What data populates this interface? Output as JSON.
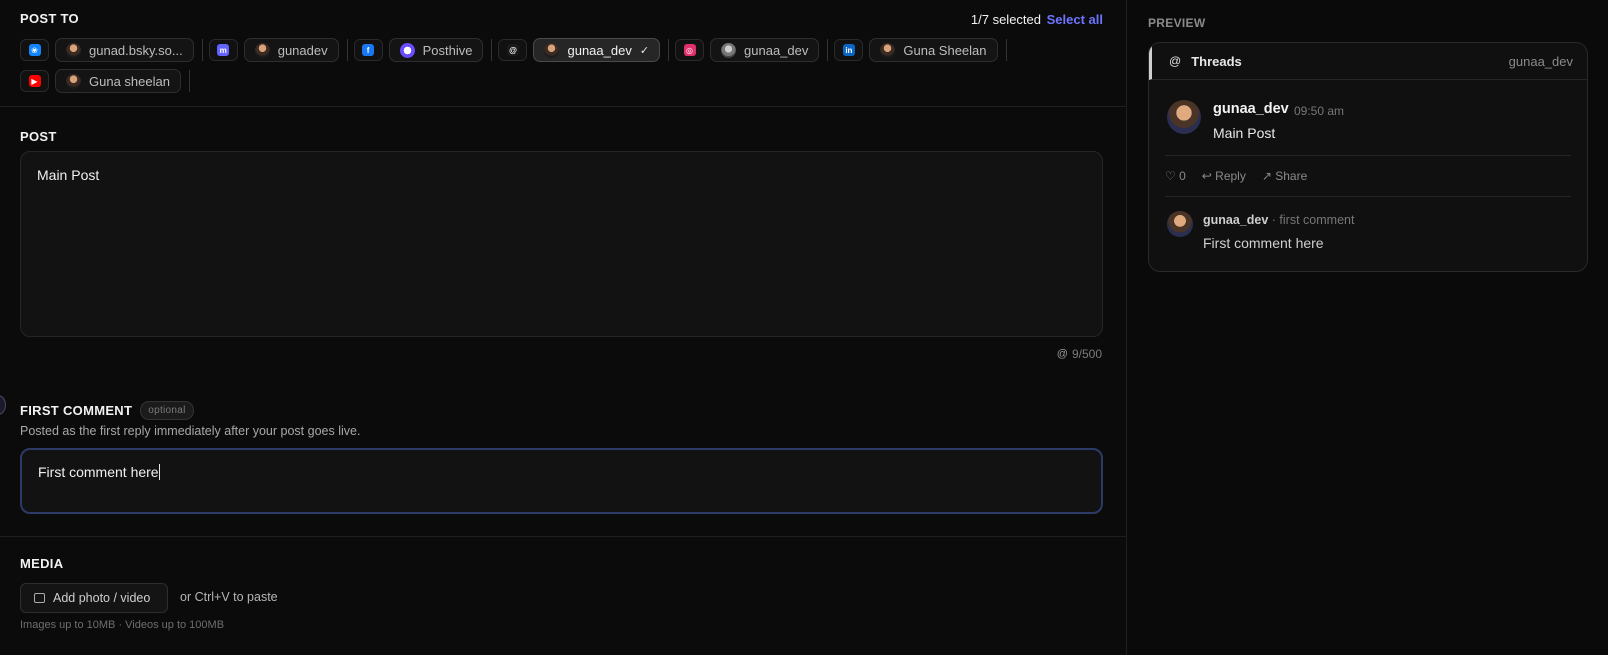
{
  "post_to": {
    "label": "POST TO",
    "selected_count": "1/7 selected",
    "select_all": "Select all",
    "row1": [
      {
        "platform": "bluesky-icon",
        "color": "#1185fe",
        "glyph": "❀",
        "account": "gunad.bsky.so...",
        "active": false
      },
      {
        "platform": "mastodon-icon",
        "color": "#6364ff",
        "glyph": "m",
        "account": "gunadev",
        "active": false
      },
      {
        "platform": "facebook-icon",
        "color": "#1877f2",
        "glyph": "f",
        "account": "Posthive",
        "active": false
      },
      {
        "platform": "threads-icon",
        "color": "#1a1a1a",
        "glyph": "@",
        "account": "gunaa_dev",
        "active": true
      },
      {
        "platform": "instagram-icon",
        "color": "#e1306c",
        "glyph": "◎",
        "account": "gunaa_dev",
        "active": false
      },
      {
        "platform": "linkedin-icon",
        "color": "#0a66c2",
        "glyph": "in",
        "account": "Guna Sheelan",
        "active": false
      }
    ],
    "row2": [
      {
        "platform": "youtube-icon",
        "color": "#ff0000",
        "glyph": "▶",
        "account": "Guna sheelan",
        "active": false
      }
    ],
    "check": "✓"
  },
  "post": {
    "label": "POST",
    "text": "Main Post",
    "counter": "9/500",
    "counter_icon": "@"
  },
  "first_comment": {
    "label": "FIRST COMMENT",
    "badge": "optional",
    "description": "Posted as the first reply immediately after your post goes live.",
    "text": "First comment here"
  },
  "media": {
    "label": "MEDIA",
    "add_button": "Add photo / video",
    "paste_hint": "or Ctrl+V to paste",
    "limits": "Images up to 10MB · Videos up to 100MB"
  },
  "preview": {
    "label": "PREVIEW",
    "platform": "Threads",
    "platform_icon": "@",
    "handle": "gunaa_dev",
    "post_name": "gunaa_dev",
    "post_time": "09:50 am",
    "post_text": "Main Post",
    "likes": "♡ 0",
    "reply": "↩ Reply",
    "share": "↗ Share",
    "comment_name": "gunaa_dev",
    "comment_tag": "· first comment",
    "comment_text": "First comment here"
  }
}
